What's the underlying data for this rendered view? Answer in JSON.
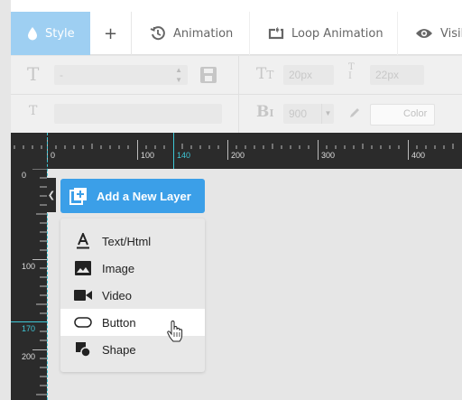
{
  "tabs": {
    "style": "Style",
    "plus": "+",
    "animation": "Animation",
    "loop_animation": "Loop Animation",
    "visibility": "Visib"
  },
  "props": {
    "font_family_value": "-",
    "font_size": "20px",
    "line_height": "22px",
    "font_weight": "900",
    "color_label": "Color"
  },
  "ruler": {
    "h_labels": [
      "0",
      "100",
      "140",
      "200",
      "300",
      "400"
    ],
    "v_labels": [
      "0",
      "100",
      "170",
      "200"
    ]
  },
  "add_layer": {
    "label": "Add a New Layer"
  },
  "menu": {
    "items": [
      {
        "label": "Text/Html",
        "icon": "text-icon"
      },
      {
        "label": "Image",
        "icon": "image-icon"
      },
      {
        "label": "Video",
        "icon": "video-icon"
      },
      {
        "label": "Button",
        "icon": "button-icon"
      },
      {
        "label": "Shape",
        "icon": "shape-icon"
      }
    ]
  },
  "colors": {
    "accent": "#3b9fe8",
    "tab_active": "#9ecff2",
    "guide": "#3fc7d6",
    "ruler_bg": "#2b2b2b"
  }
}
